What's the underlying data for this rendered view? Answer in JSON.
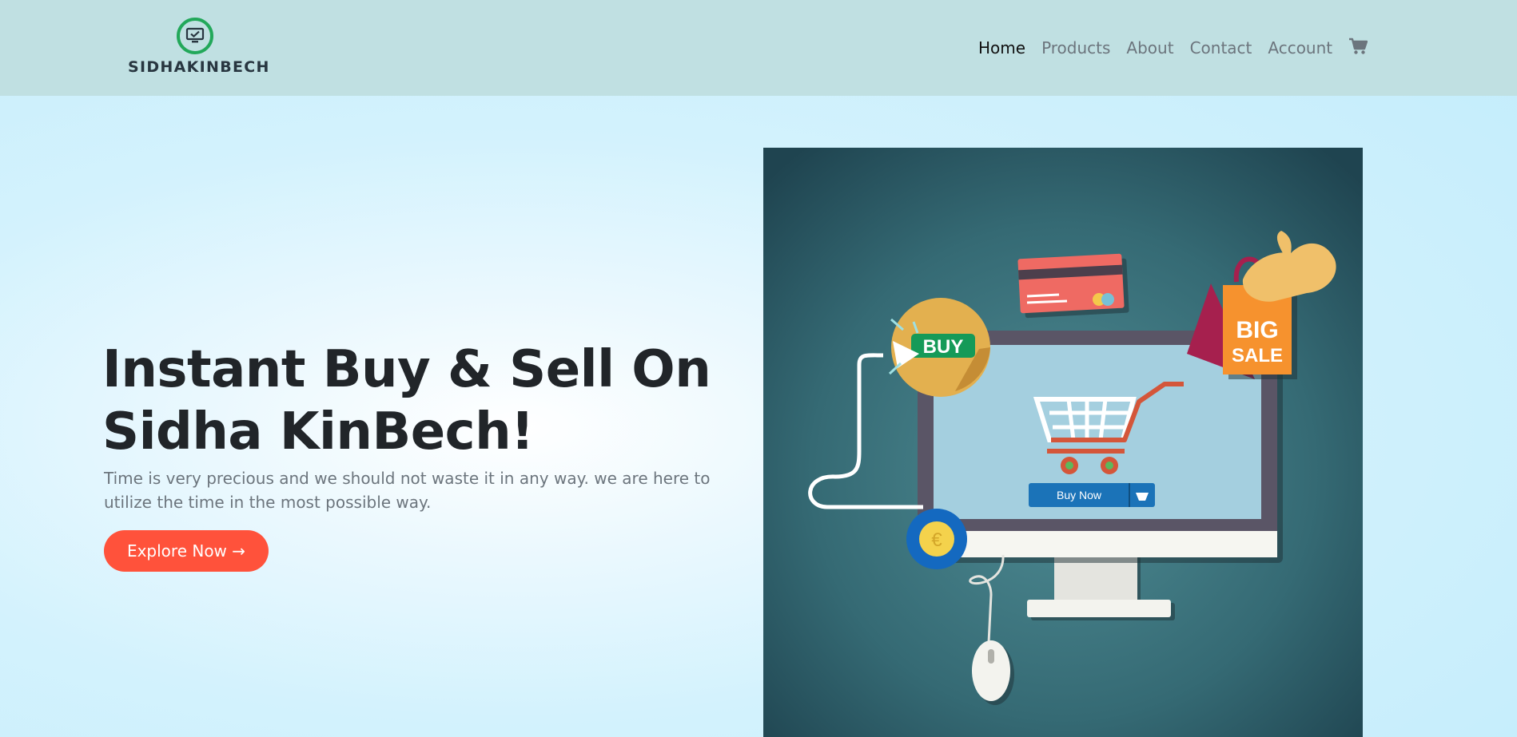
{
  "brand": {
    "logo_text": "SIDHAKINBECH",
    "icon": "monitor-check-icon"
  },
  "nav": {
    "items": [
      {
        "label": "Home",
        "active": true
      },
      {
        "label": "Products"
      },
      {
        "label": "About"
      },
      {
        "label": "Contact"
      },
      {
        "label": "Account"
      }
    ],
    "cart_icon": "shopping-cart-icon"
  },
  "hero": {
    "title_line1": "Instant Buy & Sell On",
    "title_line2": "Sidha KinBech!",
    "description": "Time is very precious and we should not waste it in any way. we are here to utilize the time in the most possible way.",
    "cta_label": "Explore Now →"
  },
  "illustration": {
    "buy_badge": "BUY",
    "sale_bag_line1": "BIG",
    "sale_bag_line2": "SALE",
    "buy_now_button": "Buy Now",
    "coin_symbol": "€"
  },
  "colors": {
    "navbar_bg": "#c0e0e2",
    "accent": "#ff523b",
    "logo_green": "#22a85a",
    "illustration_bg": "#2f5f6a"
  }
}
